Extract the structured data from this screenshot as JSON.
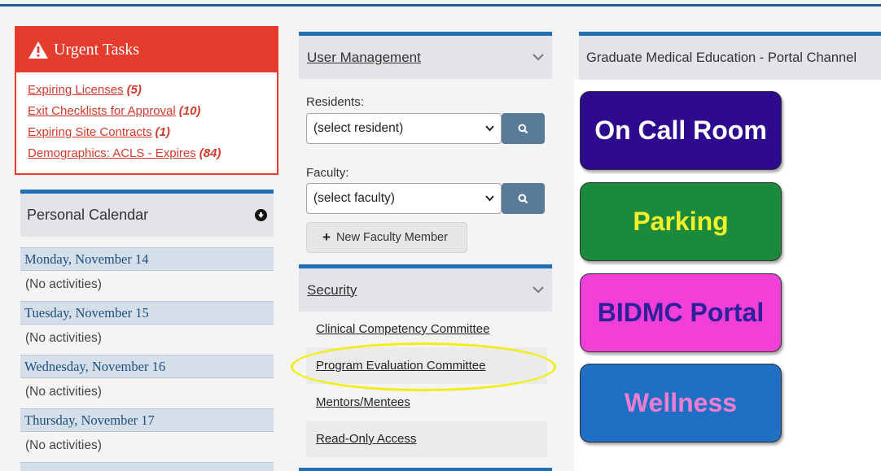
{
  "urgent": {
    "title": "Urgent Tasks",
    "items": [
      {
        "label": "Expiring Licenses",
        "count": "(5)"
      },
      {
        "label": "Exit Checklists for Approval",
        "count": "(10)"
      },
      {
        "label": "Expiring Site Contracts",
        "count": "(1)"
      },
      {
        "label": "Demographics: ACLS - Expires",
        "count": "(84)"
      }
    ]
  },
  "calendar": {
    "title": "Personal Calendar",
    "days": [
      {
        "date": "Monday, November 14",
        "activity": "(No activities)"
      },
      {
        "date": "Tuesday, November 15",
        "activity": "(No activities)"
      },
      {
        "date": "Wednesday, November 16",
        "activity": "(No activities)"
      },
      {
        "date": "Thursday, November 17",
        "activity": "(No activities)"
      }
    ]
  },
  "user_management": {
    "title": "User Management",
    "residents_label": "Residents:",
    "residents_value": "(select resident)",
    "faculty_label": "Faculty:",
    "faculty_value": "(select faculty)",
    "new_faculty_label": "New Faculty Member"
  },
  "security": {
    "title": "Security",
    "items": [
      "Clinical Competency Committee",
      "Program Evaluation Committee",
      "Mentors/Mentees",
      "Read-Only Access"
    ]
  },
  "portal": {
    "title": "Graduate Medical Education - Portal Channel",
    "buttons": [
      {
        "label": "On Call Room",
        "bg": "#2e0a8f",
        "fg": "#ffffff"
      },
      {
        "label": "Parking",
        "bg": "#1c8a3c",
        "fg": "#f3f02a"
      },
      {
        "label": "BIDMC Portal",
        "bg": "#f13fd8",
        "fg": "#2e1f9a"
      },
      {
        "label": "Wellness",
        "bg": "#1f6fc4",
        "fg": "#f07ed0"
      }
    ]
  },
  "colors": {
    "urgent_red": "#e53c2e",
    "accent_blue": "#1e6fb8",
    "highlight_yellow": "#f2ec17"
  }
}
